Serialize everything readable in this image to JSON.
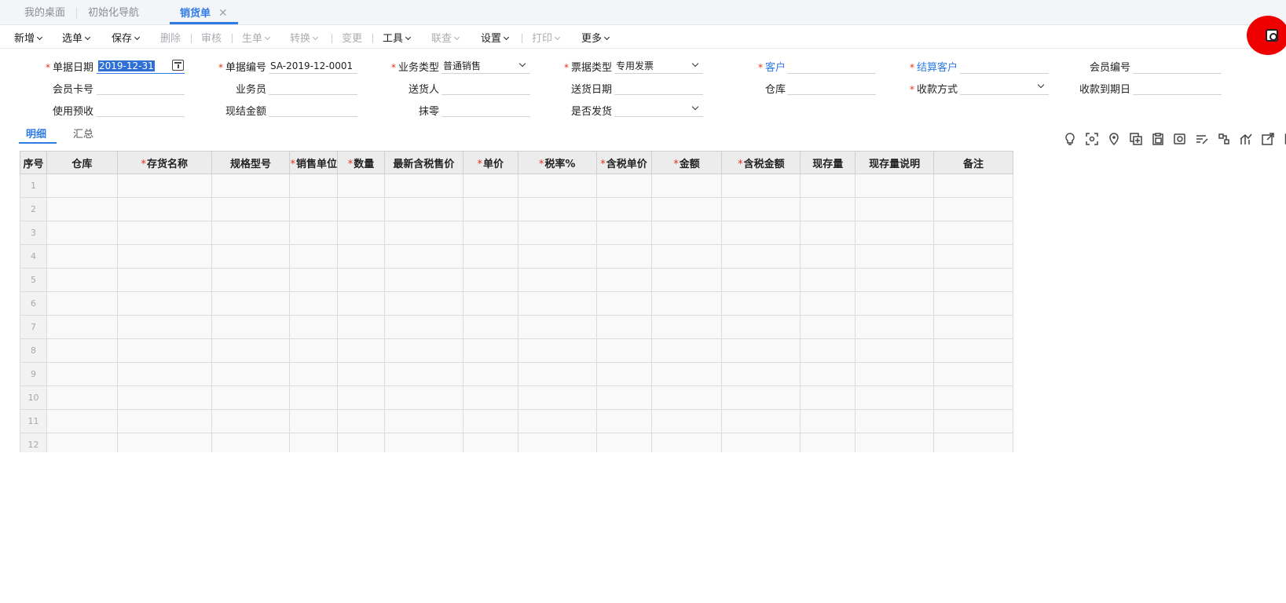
{
  "tabs": [
    {
      "label": "我的桌面"
    },
    {
      "label": "初始化导航"
    },
    {
      "label": "销货单",
      "close": "✕"
    }
  ],
  "toolbar": {
    "new": "新增",
    "select": "选单",
    "save": "保存",
    "delete": "删除",
    "audit": "审核",
    "generate": "生单",
    "convert": "转换",
    "change": "变更",
    "tools": "工具",
    "linkq": "联查",
    "settings": "设置",
    "print": "打印",
    "more": "更多"
  },
  "form": {
    "doc_date": {
      "label": "单据日期",
      "value": "2019-12-31"
    },
    "doc_no": {
      "label": "单据编号",
      "value": "SA-2019-12-0001"
    },
    "biz_type": {
      "label": "业务类型",
      "value": "普通销售"
    },
    "invoice_type": {
      "label": "票据类型",
      "value": "专用发票"
    },
    "customer": {
      "label": "客户",
      "value": ""
    },
    "settle_customer": {
      "label": "结算客户",
      "value": ""
    },
    "member_no": {
      "label": "会员编号",
      "value": ""
    },
    "member_card": {
      "label": "会员卡号",
      "value": ""
    },
    "salesman": {
      "label": "业务员",
      "value": ""
    },
    "deliverer": {
      "label": "送货人",
      "value": ""
    },
    "delivery_date": {
      "label": "送货日期",
      "value": ""
    },
    "warehouse": {
      "label": "仓库",
      "value": ""
    },
    "pay_method": {
      "label": "收款方式",
      "value": ""
    },
    "due_date": {
      "label": "收款到期日",
      "value": ""
    },
    "use_prepay": {
      "label": "使用预收",
      "value": ""
    },
    "cash_amount": {
      "label": "现结金额",
      "value": ""
    },
    "round_off": {
      "label": "抹零",
      "value": ""
    },
    "is_shipped": {
      "label": "是否发货",
      "value": ""
    }
  },
  "subtabs": [
    "明细",
    "汇总"
  ],
  "icons": [
    "bulb-icon",
    "scan-icon",
    "location-icon",
    "add-row-icon",
    "paste-icon",
    "copy-icon",
    "batch-icon",
    "split-icon",
    "chart-icon",
    "export-icon",
    "more-icon"
  ],
  "grid": {
    "columns": [
      {
        "label": "序号",
        "required": false
      },
      {
        "label": "仓库",
        "required": false
      },
      {
        "label": "存货名称",
        "required": true
      },
      {
        "label": "规格型号",
        "required": false
      },
      {
        "label": "销售单位",
        "required": true
      },
      {
        "label": "数量",
        "required": true
      },
      {
        "label": "最新含税售价",
        "required": false
      },
      {
        "label": "单价",
        "required": true
      },
      {
        "label": "税率%",
        "required": true
      },
      {
        "label": "含税单价",
        "required": true
      },
      {
        "label": "金额",
        "required": true
      },
      {
        "label": "含税金额",
        "required": true
      },
      {
        "label": "现存量",
        "required": false
      },
      {
        "label": "现存量说明",
        "required": false
      },
      {
        "label": "备注",
        "required": false
      }
    ],
    "row_numbers": [
      "1",
      "2",
      "3",
      "4",
      "5",
      "6",
      "7",
      "8",
      "9",
      "10",
      "11",
      "12"
    ]
  },
  "colors": {
    "accent": "#2f7be5",
    "required": "#e3311d",
    "header_bg": "#ececec"
  }
}
